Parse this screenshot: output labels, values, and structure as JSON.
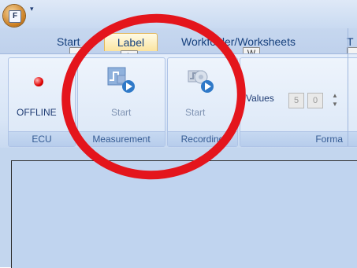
{
  "titlebar": {
    "app_letter": "F",
    "qat_glyph": "▾"
  },
  "tabs": [
    {
      "label": "Start",
      "keytip": "",
      "active": false
    },
    {
      "label": "Label",
      "keytip": "L",
      "active": true
    },
    {
      "label": "Workfolder/Worksheets",
      "keytip": "W",
      "active": false
    },
    {
      "label": "T",
      "keytip": "",
      "active": false
    }
  ],
  "ribbon": {
    "ecu": {
      "button_label": "OFFLINE",
      "group_label": "ECU"
    },
    "measurement": {
      "button_label": "Start",
      "group_label": "Measurement"
    },
    "recording": {
      "button_label": "Start",
      "group_label": "Recording"
    },
    "format": {
      "values_label": "Values",
      "value_a": "5",
      "value_b": "0",
      "group_label": "Forma"
    }
  },
  "annotation": {
    "color": "#e4151c"
  },
  "icons": [
    "app-orb-icon",
    "status-led-icon",
    "measurement-start-icon",
    "recording-start-icon",
    "spinner-arrows-icon"
  ]
}
